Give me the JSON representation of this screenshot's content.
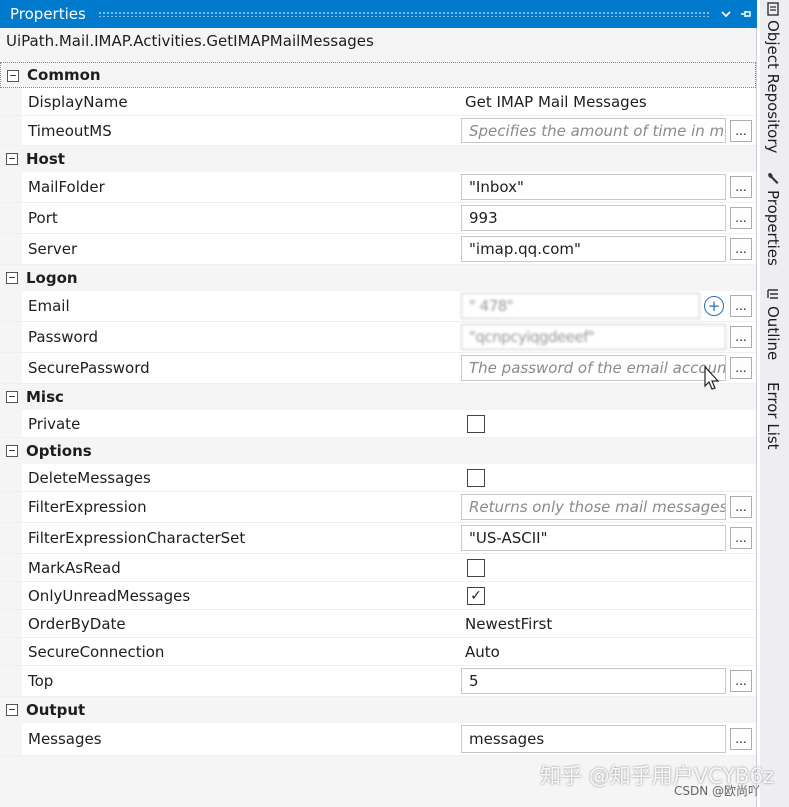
{
  "panel": {
    "title": "Properties",
    "title_dropdown_icon": "chevron-down-icon",
    "title_pin_icon": "pin-icon",
    "selected_type": "UiPath.Mail.IMAP.Activities.GetIMAPMailMessages"
  },
  "categories": {
    "common": {
      "label": "Common",
      "display_name": {
        "label": "DisplayName",
        "value": "Get IMAP Mail Messages"
      },
      "timeout_ms": {
        "label": "TimeoutMS",
        "placeholder": "Specifies the amount of time in mil"
      }
    },
    "host": {
      "label": "Host",
      "mail_folder": {
        "label": "MailFolder",
        "value": "\"Inbox\""
      },
      "port": {
        "label": "Port",
        "value": "993"
      },
      "server": {
        "label": "Server",
        "value": "\"imap.qq.com\""
      }
    },
    "logon": {
      "label": "Logon",
      "email": {
        "label": "Email",
        "value": "\"          478\""
      },
      "password": {
        "label": "Password",
        "value": "\"qcnpcyiqgdeeef\""
      },
      "secure_password": {
        "label": "SecurePassword",
        "placeholder": "The password of the email account"
      }
    },
    "misc": {
      "label": "Misc",
      "private": {
        "label": "Private",
        "checked": false
      }
    },
    "options": {
      "label": "Options",
      "delete_messages": {
        "label": "DeleteMessages",
        "checked": false
      },
      "filter_expression": {
        "label": "FilterExpression",
        "placeholder": "Returns only those mail messages t"
      },
      "filter_charset": {
        "label": "FilterExpressionCharacterSet",
        "value": "\"US-ASCII\""
      },
      "mark_as_read": {
        "label": "MarkAsRead",
        "checked": false
      },
      "only_unread": {
        "label": "OnlyUnreadMessages",
        "checked": true,
        "check_mark": "✓"
      },
      "order_by_date": {
        "label": "OrderByDate",
        "value": "NewestFirst"
      },
      "secure_connection": {
        "label": "SecureConnection",
        "value": "Auto"
      },
      "top": {
        "label": "Top",
        "value": "5"
      }
    },
    "output": {
      "label": "Output",
      "messages": {
        "label": "Messages",
        "value": "messages"
      }
    }
  },
  "common_ui": {
    "collapse_glyph": "−",
    "ellipsis": "...",
    "add_glyph": "+"
  },
  "sidebar": {
    "tabs": [
      {
        "label": "Object Repository",
        "icon": "repository-icon"
      },
      {
        "label": "Properties",
        "icon": "wrench-icon"
      },
      {
        "label": "Outline",
        "icon": "outline-icon"
      },
      {
        "label": "Error List",
        "icon": ""
      }
    ]
  },
  "watermark": {
    "zhihu": "知乎 @知乎用户VCYB6z",
    "csdn": "CSDN @欧尚吖"
  },
  "colors": {
    "title_bar": "#007acc",
    "panel_bg": "#f5f5f5",
    "sidebar_bg": "#eeeef2",
    "add_icon": "#2a6ebf"
  }
}
